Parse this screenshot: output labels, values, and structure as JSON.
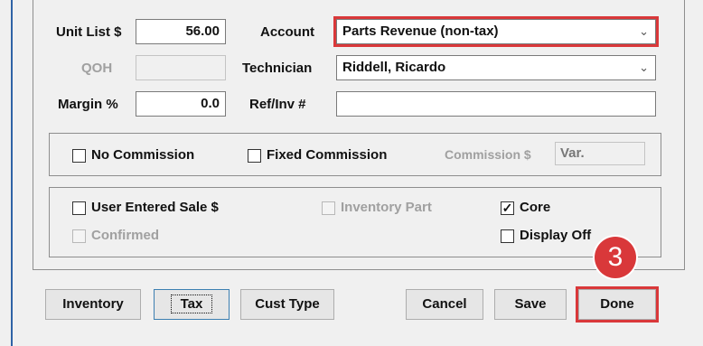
{
  "fields": {
    "unit_list_label": "Unit List $",
    "unit_list_value": "56.00",
    "qoh_label": "QOH",
    "qoh_value": "",
    "margin_label": "Margin %",
    "margin_value": "0.0",
    "account_label": "Account",
    "account_value": "Parts Revenue (non-tax)",
    "technician_label": "Technician",
    "technician_value": "Riddell, Ricardo",
    "ref_inv_label": "Ref/Inv #",
    "ref_inv_value": ""
  },
  "commission": {
    "no_commission_label": "No Commission",
    "no_commission_checked": false,
    "fixed_commission_label": "Fixed Commission",
    "fixed_commission_checked": false,
    "commission_amount_label": "Commission $",
    "commission_amount_value": "Var."
  },
  "options": {
    "user_entered_sale_label": "User Entered Sale $",
    "user_entered_sale_checked": false,
    "inventory_part_label": "Inventory Part",
    "inventory_part_checked": false,
    "core_label": "Core",
    "core_checked": true,
    "core_check_glyph": "✓",
    "confirmed_label": "Confirmed",
    "confirmed_checked": false,
    "display_off_label": "Display Off",
    "display_off_checked": false
  },
  "buttons": {
    "inventory": "Inventory",
    "tax": "Tax",
    "cust_type": "Cust Type",
    "cancel": "Cancel",
    "save": "Save",
    "done": "Done"
  },
  "annotation": {
    "step_number": "3",
    "highlight_color": "#d9383a"
  },
  "icons": {
    "dropdown": "chevron-down-icon",
    "dropdown_glyph": "⌄"
  }
}
